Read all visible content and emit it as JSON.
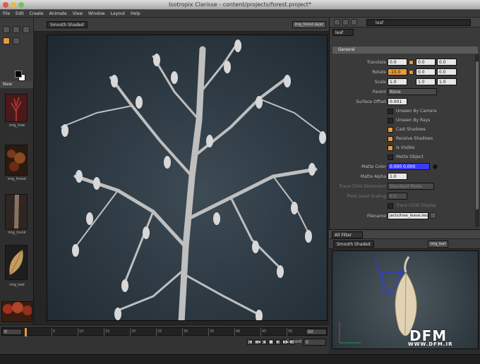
{
  "window": {
    "title": "Isotropix Clarisse - content/projects/forest.project*"
  },
  "menu": [
    "File",
    "Edit",
    "Create",
    "Animate",
    "View",
    "Window",
    "Layout",
    "Help"
  ],
  "left": {
    "new_label": "New",
    "assets": [
      {
        "label": "img_tree",
        "color": "#5a1d1d"
      },
      {
        "label": "img_forest",
        "color": "#4a2a16"
      },
      {
        "label": "img_trunk",
        "color": "#5a4a3e"
      },
      {
        "label": "img_leaf",
        "color": "#c69b5f"
      }
    ]
  },
  "viewport": {
    "camera": "Smooth Shaded",
    "image_tag": "img_forest.layer"
  },
  "timeline": {
    "start": "0",
    "end": "50",
    "ticks": [
      "5",
      "10",
      "15",
      "20",
      "25",
      "30",
      "35",
      "40",
      "45",
      "50"
    ],
    "current_label": "Current",
    "current": "0"
  },
  "props": {
    "search": "leaf",
    "tab": "leaf",
    "section": "General",
    "translate": [
      "0.0",
      "0.0",
      "0.0"
    ],
    "rotate": [
      "-15.0",
      "0.0",
      "0.0"
    ],
    "scale": [
      "1.0",
      "1.0",
      "1.0"
    ],
    "parent_label": "Parent",
    "parent_value": "None",
    "surface_offset_label": "Surface Offset",
    "surface_offset_value": "0.001",
    "checks": [
      {
        "label": "Unseen By Camera",
        "on": false
      },
      {
        "label": "Unseen By Rays",
        "on": false
      },
      {
        "label": "Cast Shadows",
        "on": true
      },
      {
        "label": "Receive Shadows",
        "on": true
      },
      {
        "label": "Is Visible",
        "on": true
      },
      {
        "label": "Matte Object",
        "on": false
      }
    ],
    "matte_color_label": "Matte Color",
    "matte_color_values": [
      "0.000",
      "0.000"
    ],
    "matte_alpha_label": "Matte Alpha",
    "matte_alpha_value": "1.0",
    "row_a_label": "Trace Child Dimension",
    "row_a_value": "Standard Mode",
    "row_b_label": "Pixel Level Scaling",
    "row_b_value": "0.0",
    "row_c_label": "Trace Child Display",
    "filename_label": "Filename",
    "filename_value": "jects/tree_leave.lwo"
  },
  "filter": {
    "label": "All Filter"
  },
  "mini_view": {
    "camera": "Smooth Shaded",
    "image_tag": "img_leaf"
  },
  "watermark": {
    "logo": "DFM",
    "url": "WWW.DFM.IR"
  },
  "colors": {
    "accent": "#e89a3c",
    "panel": "#3a3a3a",
    "background": "#2b2b2b"
  }
}
